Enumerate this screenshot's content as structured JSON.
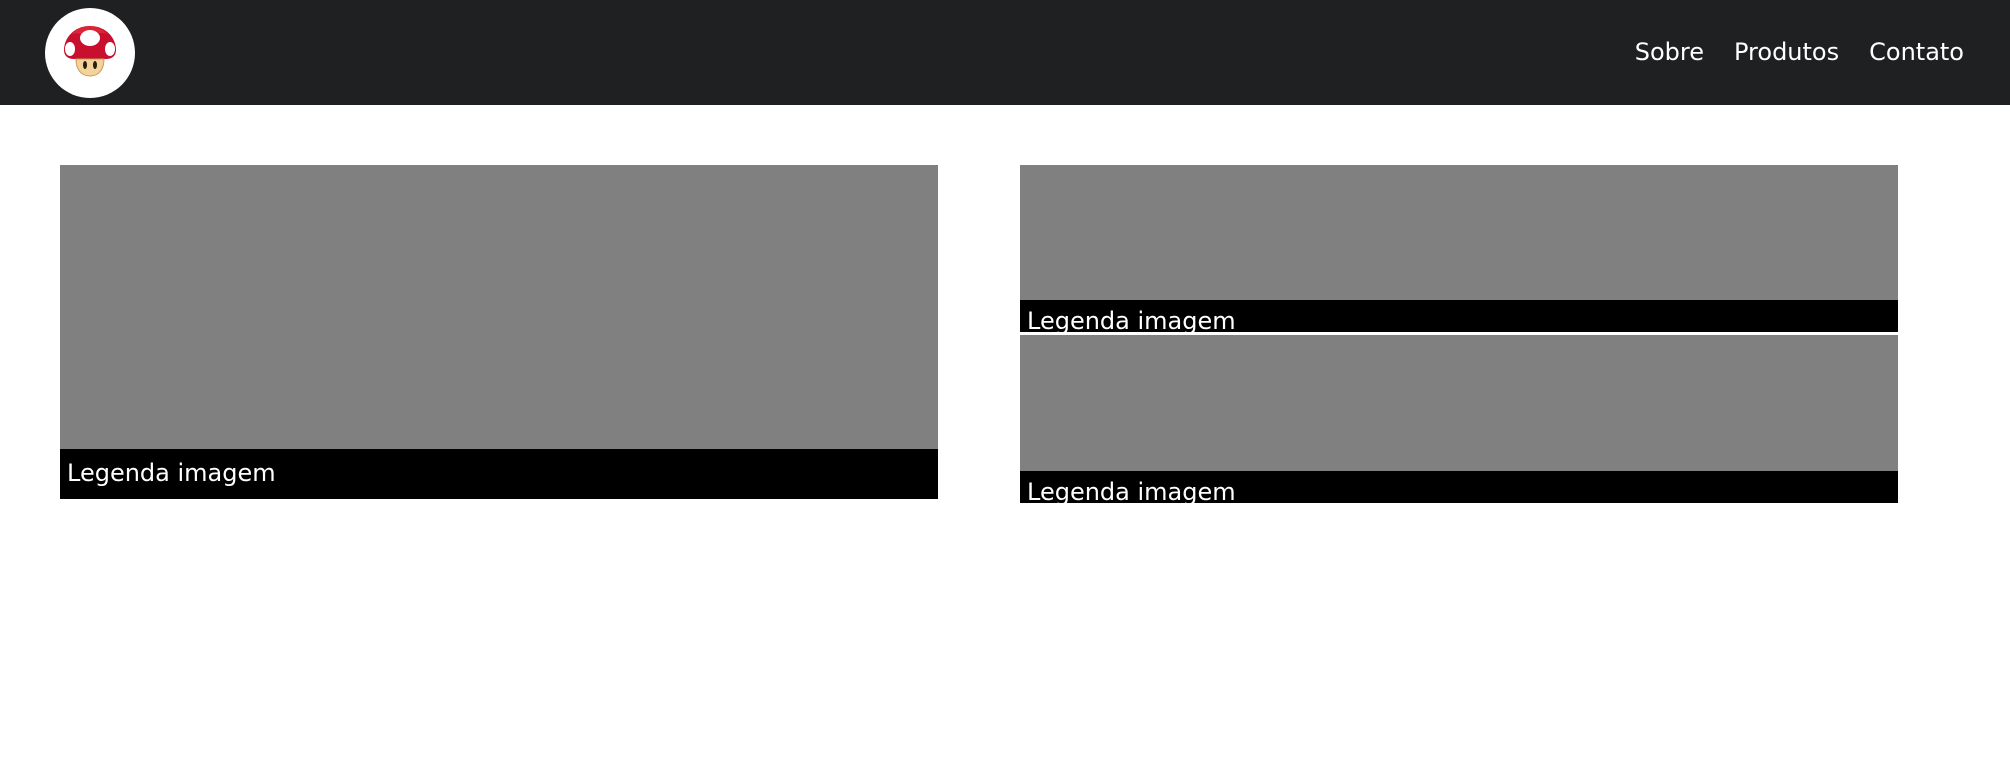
{
  "header": {
    "logo": {
      "icon": "mushroom-icon",
      "alt": ""
    },
    "nav": [
      {
        "label": "Sobre"
      },
      {
        "label": "Produtos"
      },
      {
        "label": "Contato"
      }
    ],
    "colors": {
      "background": "#1f2022",
      "text": "#ffffff"
    }
  },
  "gallery": {
    "cards": [
      {
        "caption": "Legenda imagem"
      },
      {
        "caption": "Legenda imagem"
      },
      {
        "caption": "Legenda imagem"
      }
    ],
    "colors": {
      "placeholder": "#808080",
      "caption_bg": "#000000",
      "caption_text": "#ffffff"
    }
  }
}
